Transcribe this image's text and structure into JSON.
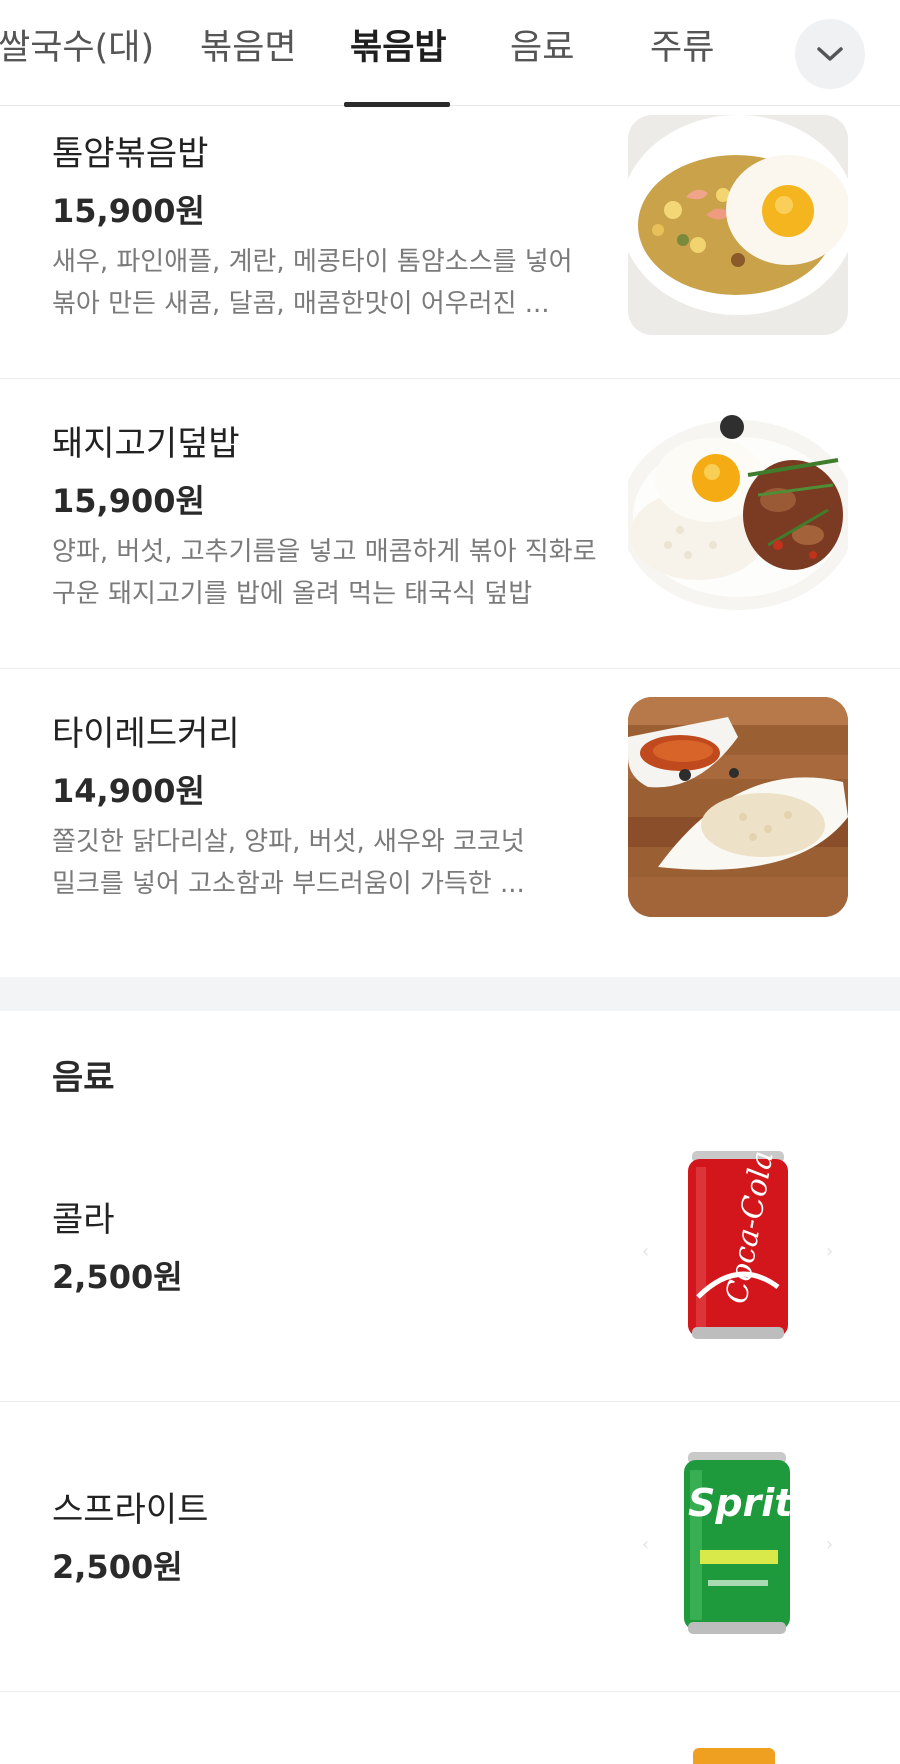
{
  "tabs": [
    {
      "label": "쌀국수(대)"
    },
    {
      "label": "볶음면"
    },
    {
      "label": "볶음밥"
    },
    {
      "label": "음료"
    },
    {
      "label": "주류"
    }
  ],
  "active_tab": "볶음밥",
  "icons": {
    "expand": "chevron-down-icon"
  },
  "menu_items": [
    {
      "name": "톰얌볶음밥",
      "price": "15,900원",
      "desc_line1": "새우, 파인애플, 계란, 메콩타이 톰얌소스를 넣어",
      "desc_line2": "볶아 만든 새콤, 달콤, 매콤한맛이 어우러진 ..."
    },
    {
      "name": "돼지고기덮밥",
      "price": "15,900원",
      "desc_line1": "양파, 버섯, 고추기름을 넣고 매콤하게 볶아 직화로",
      "desc_line2": "구운 돼지고기를 밥에 올려 먹는 태국식 덮밥"
    },
    {
      "name": "타이레드커리",
      "price": "14,900원",
      "desc_line1": "쫄깃한 닭다리살, 양파, 버섯, 새우와 코코넛",
      "desc_line2": "밀크를 넣어 고소함과 부드러움이 가득한 ..."
    }
  ],
  "drinks_section": {
    "title": "음료",
    "items": [
      {
        "name": "콜라",
        "price": "2,500원",
        "can_text": "Coca-Cola"
      },
      {
        "name": "스프라이트",
        "price": "2,500원",
        "can_text": "Sprite"
      }
    ]
  },
  "colors": {
    "active_tab": "#1f1f1f",
    "section_gap": "#f3f4f6",
    "coke_red": "#d3161c",
    "sprite_green": "#1e9a3c"
  }
}
